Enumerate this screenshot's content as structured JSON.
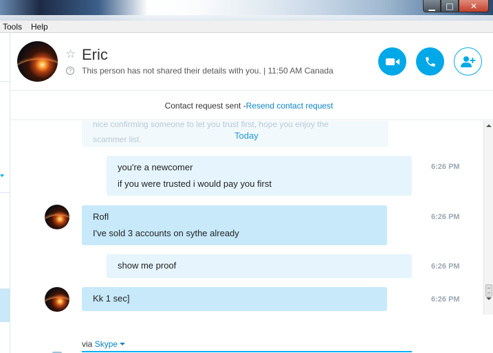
{
  "window": {
    "controls": {
      "minimize": "▁",
      "maximize": "□",
      "close": "✕"
    }
  },
  "menu": [
    "Tools",
    "Help"
  ],
  "header": {
    "contact_name": "Eric",
    "details": "This person has not shared their details with you.  |  11:50 AM Canada",
    "icons": {
      "favorite": "star-outline-icon",
      "info": "question-icon",
      "video": "video-camera-icon",
      "call": "phone-icon",
      "add": "add-person-icon"
    }
  },
  "contact_request": {
    "text": "Contact request sent - ",
    "link": "Resend contact request"
  },
  "chat": {
    "faded_text": [
      "nice confirming someone to let you trust first, hope you enjoy the",
      "scammer list."
    ],
    "date_divider": "Today",
    "messages": [
      {
        "direction": "out",
        "lines": [
          "you're a newcomer",
          "if you were trusted i would pay you first"
        ],
        "time": "6:26 PM"
      },
      {
        "direction": "in",
        "lines": [
          "Rofl",
          "I've sold 3 accounts on sythe already"
        ],
        "time": "6:26 PM"
      },
      {
        "direction": "out",
        "lines": [
          "show me proof"
        ],
        "time": "6:26 PM"
      },
      {
        "direction": "in",
        "lines": [
          "Kk 1 sec]"
        ],
        "time": "6:26 PM"
      }
    ]
  },
  "compose": {
    "via_label": "via ",
    "via_service": "Skype"
  },
  "colors": {
    "accent": "#00a8e8",
    "bubble_outgoing": "#e6f5fd",
    "bubble_incoming": "#c7e9fa",
    "link": "#0a84c2"
  }
}
